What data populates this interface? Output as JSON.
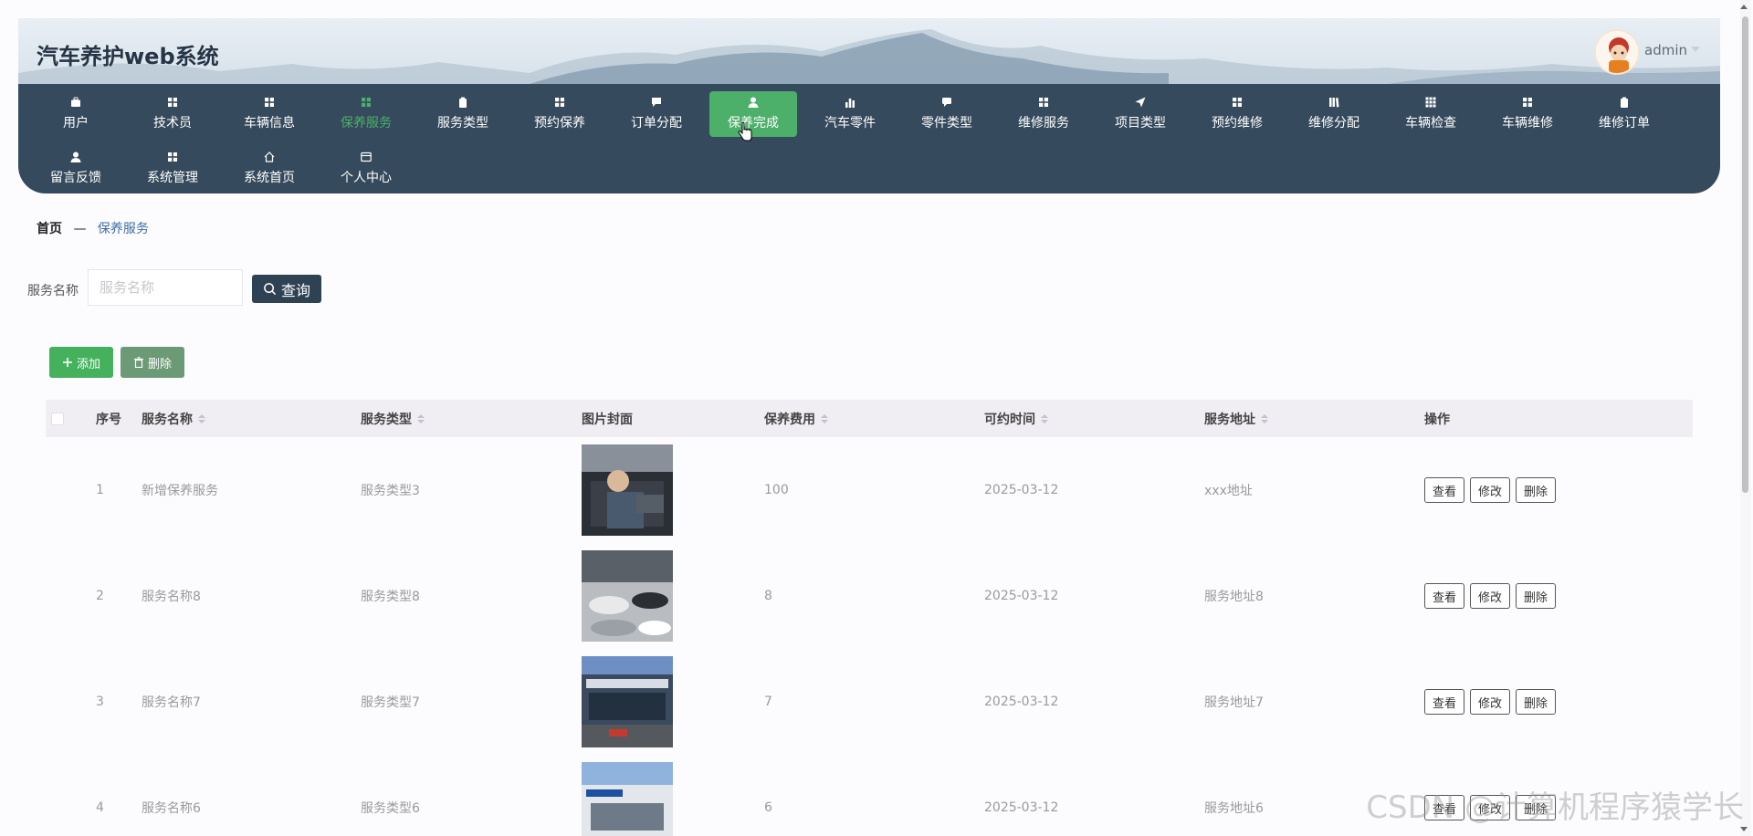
{
  "app": {
    "title": "汽车养护web系统",
    "user": "admin"
  },
  "nav": {
    "row1": [
      {
        "label": "用户",
        "icon": "briefcase-icon",
        "state": "normal"
      },
      {
        "label": "技术员",
        "icon": "grid-icon",
        "state": "normal"
      },
      {
        "label": "车辆信息",
        "icon": "grid-icon",
        "state": "normal"
      },
      {
        "label": "保养服务",
        "icon": "grid-icon",
        "state": "active"
      },
      {
        "label": "服务类型",
        "icon": "clipboard-icon",
        "state": "normal"
      },
      {
        "label": "预约保养",
        "icon": "grid-icon",
        "state": "normal"
      },
      {
        "label": "订单分配",
        "icon": "chat-icon",
        "state": "normal"
      },
      {
        "label": "保养完成",
        "icon": "user-icon",
        "state": "hover"
      },
      {
        "label": "汽车零件",
        "icon": "bar-chart-icon",
        "state": "normal"
      },
      {
        "label": "零件类型",
        "icon": "message-icon",
        "state": "normal"
      },
      {
        "label": "维修服务",
        "icon": "grid-icon",
        "state": "normal"
      },
      {
        "label": "项目类型",
        "icon": "send-icon",
        "state": "normal"
      },
      {
        "label": "预约维修",
        "icon": "grid-icon",
        "state": "normal"
      },
      {
        "label": "维修分配",
        "icon": "library-icon",
        "state": "normal"
      },
      {
        "label": "车辆检查",
        "icon": "grid9-icon",
        "state": "normal"
      },
      {
        "label": "车辆维修",
        "icon": "grid-icon",
        "state": "normal"
      },
      {
        "label": "维修订单",
        "icon": "clipboard-icon",
        "state": "normal"
      }
    ],
    "row2": [
      {
        "label": "留言反馈",
        "icon": "user-icon",
        "state": "normal"
      },
      {
        "label": "系统管理",
        "icon": "grid-icon",
        "state": "normal"
      },
      {
        "label": "系统首页",
        "icon": "home-icon",
        "state": "normal"
      },
      {
        "label": "个人中心",
        "icon": "card-icon",
        "state": "normal"
      }
    ]
  },
  "breadcrumb": {
    "home": "首页",
    "sep": "—",
    "current": "保养服务"
  },
  "search": {
    "label": "服务名称",
    "placeholder": "服务名称",
    "button": "查询"
  },
  "actions": {
    "add": "添加",
    "delete": "删除"
  },
  "table": {
    "headers": {
      "index": "序号",
      "name": "服务名称",
      "type": "服务类型",
      "image": "图片封面",
      "fee": "保养费用",
      "time": "可约时间",
      "address": "服务地址",
      "ops": "操作"
    },
    "rows": [
      {
        "index": "1",
        "name": "新增保养服务",
        "type": "服务类型3",
        "fee": "100",
        "time": "2025-03-12",
        "address": "xxx地址",
        "image": "mechanic"
      },
      {
        "index": "2",
        "name": "服务名称8",
        "type": "服务类型8",
        "fee": "8",
        "time": "2025-03-12",
        "address": "服务地址8",
        "image": "showroom"
      },
      {
        "index": "3",
        "name": "服务名称7",
        "type": "服务类型7",
        "fee": "7",
        "time": "2025-03-12",
        "address": "服务地址7",
        "image": "dealership"
      },
      {
        "index": "4",
        "name": "服务名称6",
        "type": "服务类型6",
        "fee": "6",
        "time": "2025-03-12",
        "address": "服务地址6",
        "image": "storefront"
      }
    ],
    "row_ops": {
      "view": "查看",
      "edit": "修改",
      "delete": "删除"
    }
  },
  "watermark": "CSDN @计算机程序猿学长",
  "colors": {
    "nav_bg": "#354a5c",
    "accent_green": "#4caf6a",
    "search_btn": "#2e4254"
  }
}
